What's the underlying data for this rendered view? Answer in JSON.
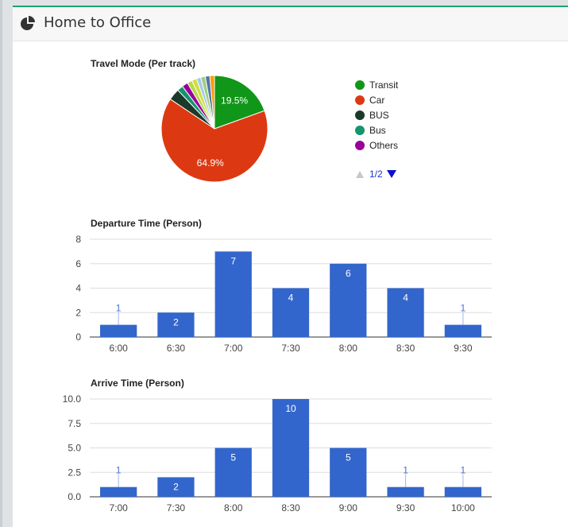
{
  "panel": {
    "title": "Home to Office",
    "icon": "pie-chart-icon"
  },
  "chart_data": [
    {
      "type": "pie",
      "title": "Travel Mode (Per track)",
      "slices": [
        {
          "label": "Transit",
          "value": 19.5,
          "color": "#109618",
          "display": "19.5%"
        },
        {
          "label": "Car",
          "value": 64.9,
          "color": "#dc3912",
          "display": "64.9%"
        },
        {
          "label": "BUS",
          "value": 3.5,
          "color": "#1c3a2a",
          "display": ""
        },
        {
          "label": "Bus",
          "value": 1.8,
          "color": "#16946c",
          "display": ""
        },
        {
          "label": "Others",
          "value": 1.8,
          "color": "#990099",
          "display": ""
        },
        {
          "label": "",
          "value": 1.5,
          "color": "#b8d84a",
          "display": ""
        },
        {
          "label": "",
          "value": 1.5,
          "color": "#d0df3c",
          "display": ""
        },
        {
          "label": "",
          "value": 1.3,
          "color": "#a5c8f0",
          "display": ""
        },
        {
          "label": "",
          "value": 1.4,
          "color": "#9fcf7f",
          "display": ""
        },
        {
          "label": "",
          "value": 1.4,
          "color": "#5574a6",
          "display": ""
        },
        {
          "label": "",
          "value": 1.4,
          "color": "#ff9900",
          "display": ""
        }
      ],
      "legend": {
        "entries": [
          "Transit",
          "Car",
          "BUS",
          "Bus",
          "Others"
        ],
        "page": "1/2",
        "placement": "right"
      }
    },
    {
      "type": "bar",
      "title": "Departure Time (Person)",
      "categories": [
        "6:00",
        "6:30",
        "7:00",
        "7:30",
        "8:00",
        "8:30",
        "9:30"
      ],
      "values": [
        1,
        2,
        7,
        4,
        6,
        4,
        1
      ],
      "yticks": [
        "0",
        "2",
        "4",
        "6",
        "8"
      ],
      "ylim": [
        0,
        8
      ],
      "grid": true,
      "color": "#3366cc"
    },
    {
      "type": "bar",
      "title": "Arrive Time (Person)",
      "categories": [
        "7:00",
        "7:30",
        "8:00",
        "8:30",
        "9:00",
        "9:30",
        "10:00"
      ],
      "values": [
        1,
        2,
        5,
        10,
        5,
        1,
        1
      ],
      "yticks": [
        "0.0",
        "2.5",
        "5.0",
        "7.5",
        "10.0"
      ],
      "ylim": [
        0,
        10
      ],
      "grid": true,
      "color": "#3366cc"
    }
  ]
}
